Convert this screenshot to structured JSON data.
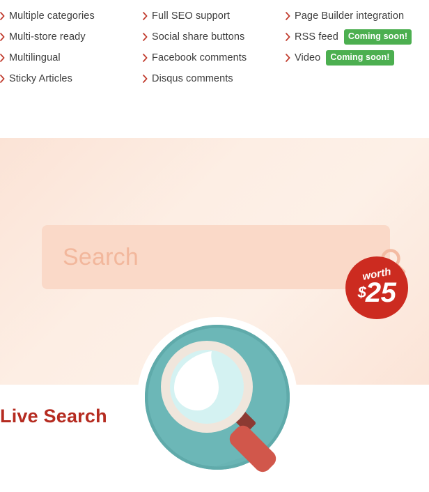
{
  "feature_list": {
    "chevron_icon": "chevron-right-icon",
    "badge_color": "#4caf50",
    "chevron_color": "#c0392b",
    "columns": [
      {
        "items": [
          {
            "label": "Multiple categories",
            "badge": null
          },
          {
            "label": "Multi-store ready",
            "badge": null
          },
          {
            "label": "Multilingual",
            "badge": null
          },
          {
            "label": "Sticky Articles",
            "badge": null
          }
        ]
      },
      {
        "items": [
          {
            "label": "Full SEO support",
            "badge": null
          },
          {
            "label": "Social share buttons",
            "badge": null
          },
          {
            "label": "Facebook comments",
            "badge": null
          },
          {
            "label": "Disqus comments",
            "badge": null
          }
        ]
      },
      {
        "items": [
          {
            "label": "Page Builder integration",
            "badge": null
          },
          {
            "label": "RSS feed",
            "badge": "Coming soon!"
          },
          {
            "label": "Video",
            "badge": "Coming soon!"
          }
        ]
      }
    ]
  },
  "hero": {
    "background_color": "#fdeee4",
    "search": {
      "placeholder": "Search",
      "value": "",
      "field_color": "#fad9c8",
      "placeholder_color": "#f2b79c",
      "submit_icon": "search-icon"
    },
    "illustration": {
      "name": "magnifying-glass-illustration",
      "ring_color": "#ffffff",
      "disc_color": "#6cb7b7",
      "disc_shadow_color": "#5faaaa",
      "lens_ring_color": "#f0e6dc",
      "lens_glass_color": "#d4f2f2",
      "lens_highlight_color": "#ffffff",
      "handle_color": "#d1574b",
      "handle_joint_color": "#8c3a32"
    },
    "worth_badge": {
      "label": "worth",
      "currency": "$",
      "amount": "25",
      "color": "#cc2b20",
      "text_color": "#ffffff"
    }
  },
  "section": {
    "heading": "Live Search",
    "heading_color": "#b52b20"
  }
}
